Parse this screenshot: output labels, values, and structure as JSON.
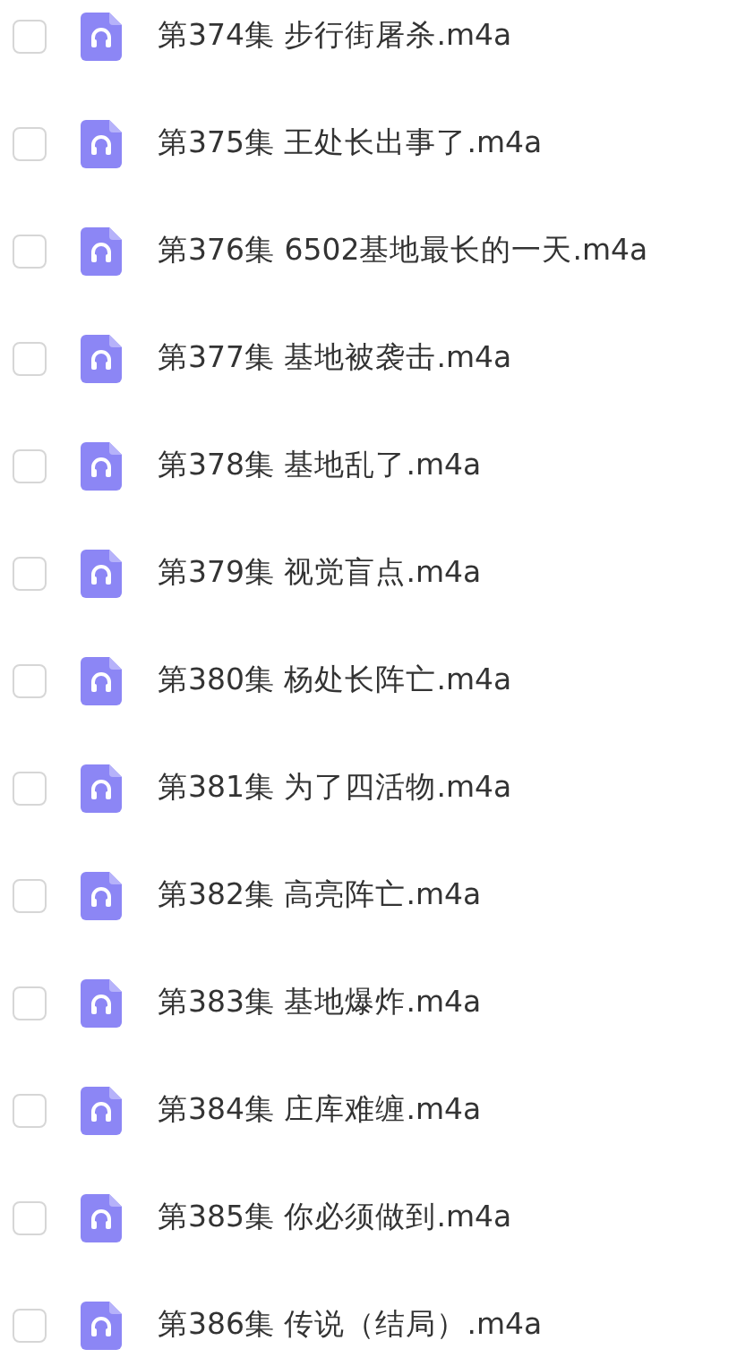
{
  "files": [
    {
      "name": "第374集 步行街屠杀.m4a",
      "checked": false
    },
    {
      "name": "第375集 王处长出事了.m4a",
      "checked": false
    },
    {
      "name": "第376集 6502基地最长的一天.m4a",
      "checked": false
    },
    {
      "name": "第377集 基地被袭击.m4a",
      "checked": false
    },
    {
      "name": "第378集 基地乱了.m4a",
      "checked": false
    },
    {
      "name": "第379集 视觉盲点.m4a",
      "checked": false
    },
    {
      "name": "第380集 杨处长阵亡.m4a",
      "checked": false
    },
    {
      "name": "第381集 为了四活物.m4a",
      "checked": false
    },
    {
      "name": "第382集 高亮阵亡.m4a",
      "checked": false
    },
    {
      "name": "第383集 基地爆炸.m4a",
      "checked": false
    },
    {
      "name": "第384集 庄库难缠.m4a",
      "checked": false
    },
    {
      "name": "第385集 你必须做到.m4a",
      "checked": false
    },
    {
      "name": "第386集 传说（结局）.m4a",
      "checked": false
    }
  ]
}
